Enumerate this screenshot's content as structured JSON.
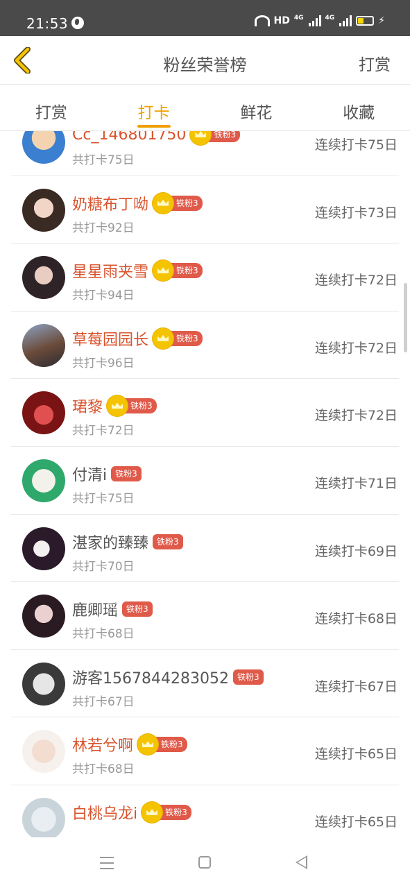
{
  "status_bar": {
    "time": "21:53",
    "hd_label": "HD",
    "network_1": "4G",
    "network_2": "4G"
  },
  "header": {
    "title": "粉丝荣誉榜",
    "action": "打赏"
  },
  "tabs": [
    "打赏",
    "打卡",
    "鲜花",
    "收藏"
  ],
  "active_tab": "打卡",
  "colors": {
    "accent": "#f0a000",
    "vip_name": "#d9532c",
    "badge": "#e05a4a",
    "crown": "#f5c400"
  },
  "fans": [
    {
      "name": "Cc_146801750",
      "vip": true,
      "badge": "铁粉3",
      "total": "共打卡75日",
      "streak": "连续打卡75日"
    },
    {
      "name": "奶糖布丁呦",
      "vip": true,
      "badge": "铁粉3",
      "total": "共打卡92日",
      "streak": "连续打卡73日"
    },
    {
      "name": "星星雨夹雪",
      "vip": true,
      "badge": "铁粉3",
      "total": "共打卡94日",
      "streak": "连续打卡72日"
    },
    {
      "name": "草莓园园长",
      "vip": true,
      "badge": "铁粉3",
      "total": "共打卡96日",
      "streak": "连续打卡72日"
    },
    {
      "name": "珺黎",
      "vip": true,
      "badge": "铁粉3",
      "total": "共打卡72日",
      "streak": "连续打卡72日"
    },
    {
      "name": "付清i",
      "vip": false,
      "badge": "铁粉3",
      "total": "共打卡75日",
      "streak": "连续打卡71日"
    },
    {
      "name": "湛家的臻臻",
      "vip": false,
      "badge": "铁粉3",
      "total": "共打卡70日",
      "streak": "连续打卡69日"
    },
    {
      "name": "鹿卿瑶",
      "vip": false,
      "badge": "铁粉3",
      "total": "共打卡68日",
      "streak": "连续打卡68日"
    },
    {
      "name": "游客1567844283052",
      "vip": false,
      "badge": "铁粉3",
      "total": "共打卡67日",
      "streak": "连续打卡67日"
    },
    {
      "name": "林若兮啊",
      "vip": true,
      "badge": "铁粉3",
      "total": "共打卡68日",
      "streak": "连续打卡65日"
    },
    {
      "name": "白桃乌龙i",
      "vip": true,
      "badge": "铁粉3",
      "total": "",
      "streak": "连续打卡65日"
    }
  ]
}
